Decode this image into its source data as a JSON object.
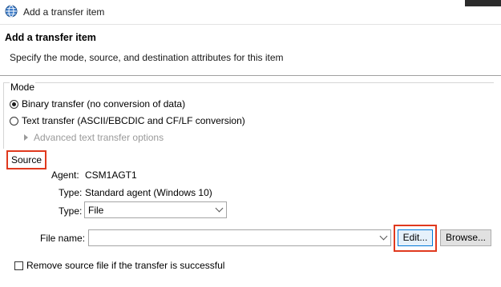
{
  "window": {
    "title": "Add a transfer item"
  },
  "banner": {
    "heading": "Add a transfer item",
    "description": "Specify the mode, source, and destination attributes for this item"
  },
  "mode": {
    "legend": "Mode",
    "options": [
      {
        "label": "Binary transfer (no conversion of data)",
        "selected": true
      },
      {
        "label": "Text transfer (ASCII/EBCDIC and CF/LF conversion)",
        "selected": false
      }
    ],
    "advanced_label": "Advanced text transfer options"
  },
  "source": {
    "legend": "Source",
    "agent_label": "Agent:",
    "agent_value": "CSM1AGT1",
    "type_label": "Type:",
    "type_value": "Standard agent (Windows 10)",
    "type_select_label": "Type:",
    "type_select_value": "File",
    "file_name_label": "File name:",
    "file_name_value": "",
    "edit_label": "Edit...",
    "browse_label": "Browse...",
    "remove_label": "Remove source file if the transfer is successful",
    "remove_checked": false
  },
  "colors": {
    "highlight": "#e0391e"
  }
}
